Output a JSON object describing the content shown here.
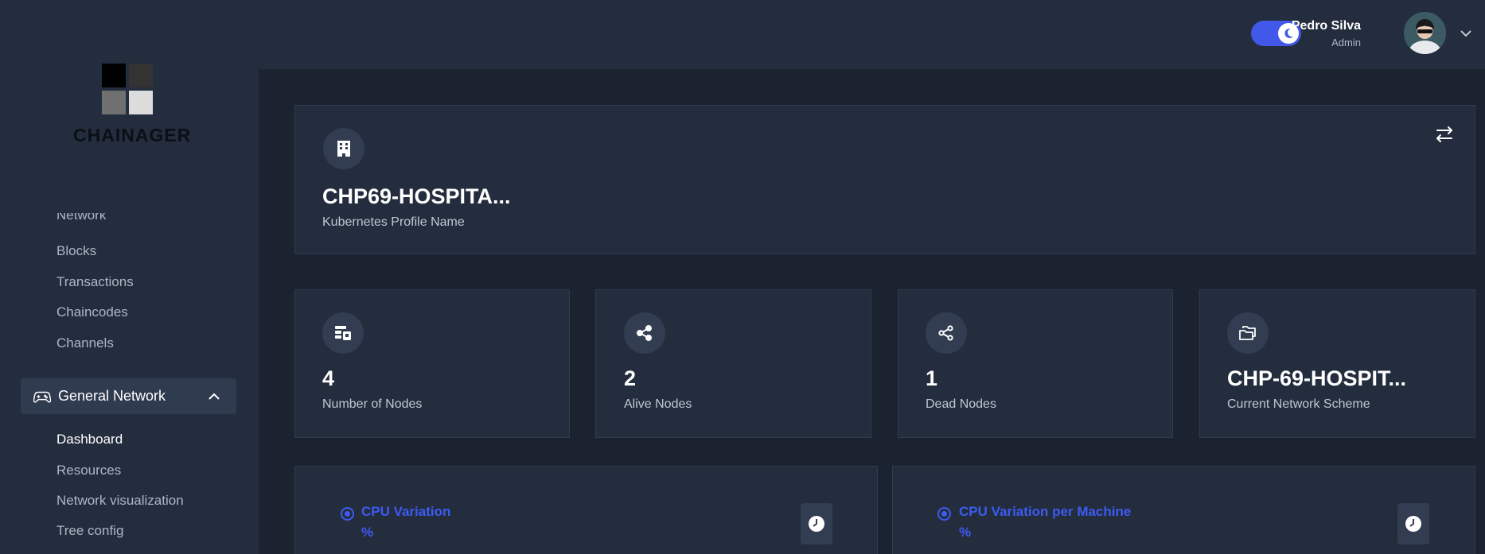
{
  "header": {
    "user_name": "Pedro Silva",
    "user_role": "Admin",
    "theme_toggle": "dark-mode"
  },
  "sidebar": {
    "logo_text": "CHAINAGER",
    "items_top": [
      {
        "label": "Network"
      },
      {
        "label": "Blocks"
      },
      {
        "label": "Transactions"
      },
      {
        "label": "Chaincodes"
      },
      {
        "label": "Channels"
      }
    ],
    "group": {
      "label": "General Network",
      "expanded": true
    },
    "items_group": [
      {
        "label": "Dashboard",
        "active": true
      },
      {
        "label": "Resources"
      },
      {
        "label": "Network visualization"
      },
      {
        "label": "Tree config"
      }
    ]
  },
  "profile_card": {
    "title": "CHP69-HOSPITA...",
    "subtitle": "Kubernetes Profile Name",
    "icon": "building-icon"
  },
  "stats": [
    {
      "value": "4",
      "label": "Number of Nodes",
      "icon": "nodes-icon"
    },
    {
      "value": "2",
      "label": "Alive Nodes",
      "icon": "share-icon"
    },
    {
      "value": "1",
      "label": "Dead Nodes",
      "icon": "share-outline-icon"
    },
    {
      "value": "CHP-69-HOSPIT...",
      "label": "Current Network Scheme",
      "icon": "folders-icon"
    }
  ],
  "charts": [
    {
      "title_line1": "CPU Variation",
      "title_line2": "%"
    },
    {
      "title_line1": "CPU Variation per Machine",
      "title_line2": "%"
    }
  ],
  "colors": {
    "accent": "#3d5bf0",
    "toggle": "#4258e8",
    "panel": "#232d3e",
    "background": "#1c2330"
  }
}
